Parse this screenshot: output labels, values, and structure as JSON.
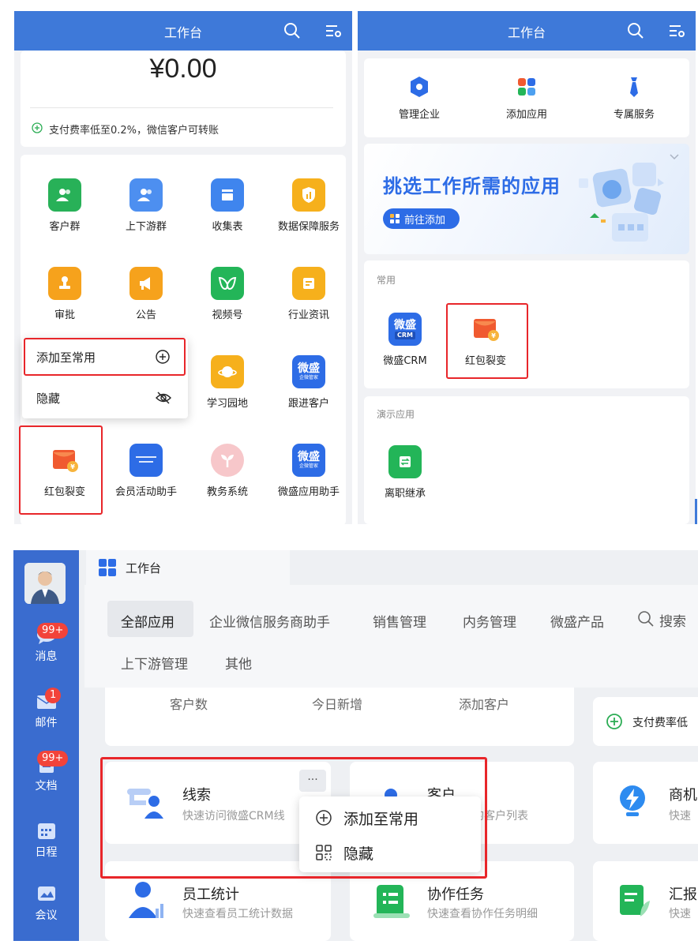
{
  "left_phone": {
    "header_title": "工作台",
    "balance": "¥0.00",
    "pay_notice": "支付费率低至0.2%，微信客户可转账",
    "apps": [
      {
        "label": "客户群",
        "color": "#28b158"
      },
      {
        "label": "上下游群",
        "color": "#4d8ff0"
      },
      {
        "label": "收集表",
        "color": "#3f85ee"
      },
      {
        "label": "数据保障服务",
        "color": "#f6b01c"
      },
      {
        "label": "审批",
        "color": "#f6a21c"
      },
      {
        "label": "公告",
        "color": "#f6a21c"
      },
      {
        "label": "视频号",
        "color": "#23b558"
      },
      {
        "label": "行业资讯",
        "color": "#f6b01c"
      },
      {
        "label": "学习园地",
        "color": "#f6b01c"
      },
      {
        "label": "跟进客户",
        "color": "#2d6ce6",
        "icon_text": "微盛"
      },
      {
        "label": "红包裂变",
        "color": "#f05a30"
      },
      {
        "label": "会员活动助手",
        "color": "#2d6ce6"
      },
      {
        "label": "教务系统",
        "color": "#f7c7ca"
      },
      {
        "label": "微盛应用助手",
        "color": "#2d6ce6",
        "icon_text": "微盛"
      }
    ],
    "icon_subtext": "企微管家",
    "context_menu": {
      "add_label": "添加至常用",
      "hide_label": "隐藏"
    }
  },
  "right_phone": {
    "header_title": "工作台",
    "quick_actions": [
      {
        "label": "管理企业"
      },
      {
        "label": "添加应用"
      },
      {
        "label": "专属服务"
      }
    ],
    "banner": {
      "headline": "挑选工作所需的应用",
      "button_label": "前往添加"
    },
    "common_section": {
      "title": "常用",
      "apps": [
        {
          "label": "微盛CRM",
          "icon_text": "微盛",
          "icon_sub": "CRM"
        },
        {
          "label": "红包裂变"
        }
      ]
    },
    "demo_section": {
      "title": "演示应用",
      "apps": [
        {
          "label": "离职继承"
        }
      ]
    }
  },
  "desktop": {
    "window_title": "工作台",
    "rail_items": [
      {
        "label": "消息",
        "badge": "99+"
      },
      {
        "label": "邮件",
        "badge": "1"
      },
      {
        "label": "文档",
        "badge": "99+"
      },
      {
        "label": "日程"
      },
      {
        "label": "会议"
      }
    ],
    "tabs_row1": [
      "全部应用",
      "企业微信服务商助手",
      "销售管理",
      "内务管理",
      "微盛产品"
    ],
    "search_label": "搜索",
    "tabs_row2": [
      "上下游管理",
      "其他"
    ],
    "stats": [
      "客户数",
      "今日新增",
      "添加客户"
    ],
    "pay_notice_short": "支付费率低",
    "app_cards": [
      {
        "title": "线索",
        "subtitle": "快速访问微盛CRM线"
      },
      {
        "title": "客户",
        "subtitle": "的客户列表"
      },
      {
        "title": "商机",
        "subtitle": "快速"
      },
      {
        "title": "员工统计",
        "subtitle": "快速查看员工统计数据"
      },
      {
        "title": "协作任务",
        "subtitle": "快速查看协作任务明细"
      },
      {
        "title": "汇报",
        "subtitle": "快速"
      }
    ],
    "more_button": "···",
    "context_menu": {
      "add_label": "添加至常用",
      "hide_label": "隐藏"
    }
  }
}
